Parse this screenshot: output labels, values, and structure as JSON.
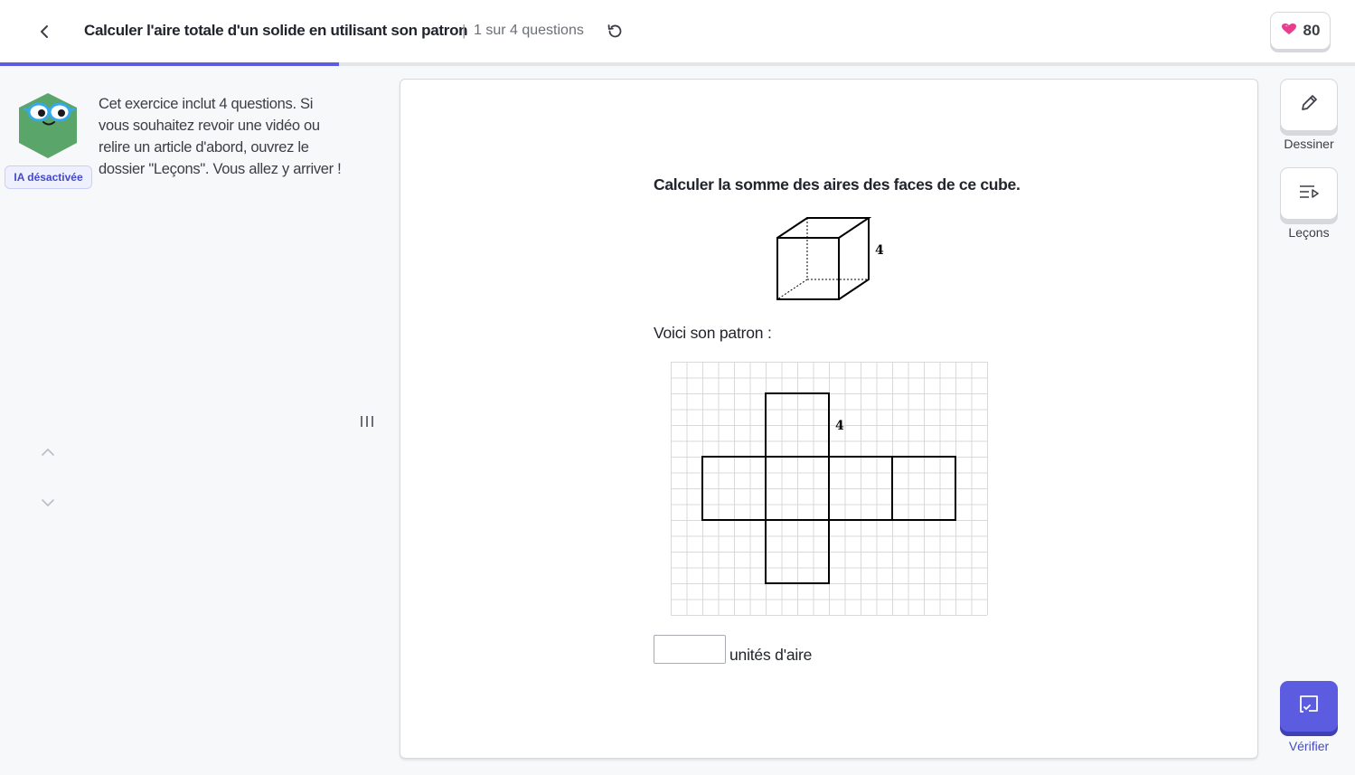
{
  "header": {
    "title": "Calculer l'aire totale d'un solide en utilisant son patron",
    "separator": "|",
    "progress_text": "1 sur 4 questions",
    "gems": "80",
    "progress_fraction": 0.25
  },
  "sidebar": {
    "ai_badge": "IA désactivée",
    "intro_text": "Cet exercice inclut 4 questions. Si vous souhaitez revoir une vidéo ou relire un article d'abord, ouvrez le dossier \"Leçons\". Vous allez y arriver !"
  },
  "exercise": {
    "question": "Calculer la somme des aires des faces de ce cube.",
    "cube_edge_label": "4",
    "net_intro": "Voici son patron :",
    "net_edge_label": "4",
    "answer_value": "",
    "unit_label": "unités d'aire"
  },
  "tools": {
    "draw_label": "Dessiner",
    "lessons_label": "Leçons",
    "verify_label": "Vérifier"
  },
  "colors": {
    "accent": "#5b5ce0",
    "gem": "#e83e8c",
    "mascot": "#5aa56a"
  },
  "icons": [
    "back-arrow-icon",
    "restart-icon",
    "gem-icon",
    "pencil-icon",
    "lessons-icon",
    "verify-icon",
    "chevron-up-icon",
    "chevron-down-icon"
  ]
}
